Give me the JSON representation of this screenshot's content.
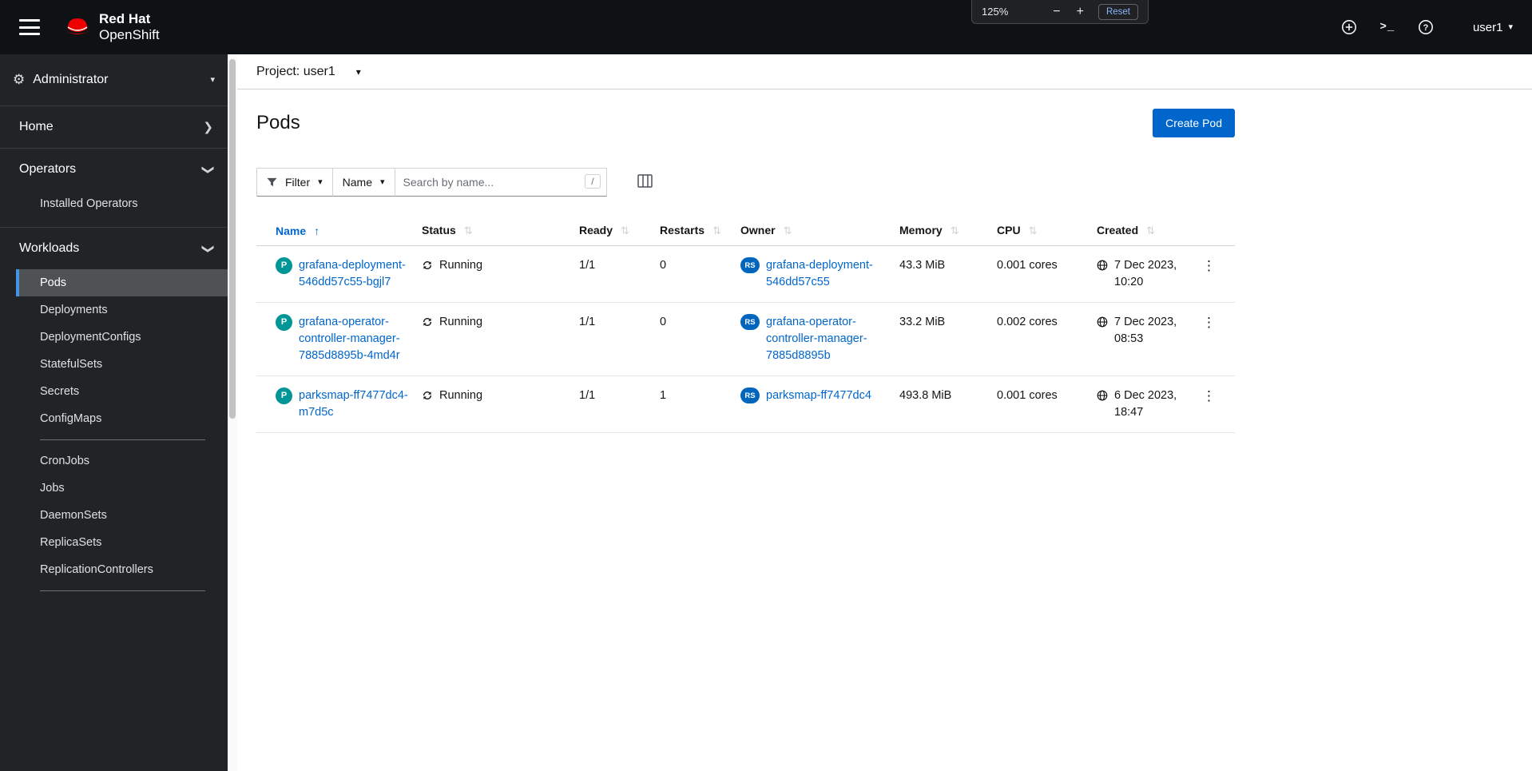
{
  "colors": {
    "accent": "#0066cc",
    "masthead_bg": "#0f1214",
    "sidebar_bg": "#212427",
    "pod_badge": "#009596",
    "replicaset_badge": "#0065bd",
    "brand_red": "#ee0000",
    "selected_nav_border": "#4394e5"
  },
  "masthead": {
    "brand_line1": "Red Hat",
    "brand_line2": "OpenShift",
    "terminal_glyph": ">_",
    "user_label": "user1"
  },
  "zoom_popup": {
    "level": "125%",
    "minus": "−",
    "plus": "+",
    "reset_label": "Reset"
  },
  "sidebar": {
    "perspective_label": "Administrator",
    "home_label": "Home",
    "operators_label": "Operators",
    "installed_operators_label": "Installed Operators",
    "workloads_label": "Workloads",
    "workloads_items": [
      "Pods",
      "Deployments",
      "DeploymentConfigs",
      "StatefulSets",
      "Secrets",
      "ConfigMaps",
      "CronJobs",
      "Jobs",
      "DaemonSets",
      "ReplicaSets",
      "ReplicationControllers"
    ],
    "selected_item": "Pods"
  },
  "project_bar": {
    "label": "Project: user1"
  },
  "page": {
    "title": "Pods",
    "create_button_label": "Create Pod"
  },
  "toolbar": {
    "filter_label": "Filter",
    "attribute_label": "Name",
    "search_placeholder": "Search by name...",
    "search_value": "",
    "shortcut_hint": "/"
  },
  "table": {
    "columns": [
      "Name",
      "Status",
      "Ready",
      "Restarts",
      "Owner",
      "Memory",
      "CPU",
      "Created"
    ],
    "sorted_by": "Name",
    "sort_direction": "ascending",
    "rows": [
      {
        "badge": "P",
        "name": "grafana-deployment-546dd57c55-bgjl7",
        "status": "Running",
        "ready": "1/1",
        "restarts": "0",
        "owner_badge": "RS",
        "owner": "grafana-deployment-546dd57c55",
        "memory": "43.3 MiB",
        "cpu": "0.001 cores",
        "created": "7 Dec 2023, 10:20"
      },
      {
        "badge": "P",
        "name": "grafana-operator-controller-manager-7885d8895b-4md4r",
        "status": "Running",
        "ready": "1/1",
        "restarts": "0",
        "owner_badge": "RS",
        "owner": "grafana-operator-controller-manager-7885d8895b",
        "memory": "33.2 MiB",
        "cpu": "0.002 cores",
        "created": "7 Dec 2023, 08:53"
      },
      {
        "badge": "P",
        "name": "parksmap-ff7477dc4-m7d5c",
        "status": "Running",
        "ready": "1/1",
        "restarts": "1",
        "owner_badge": "RS",
        "owner": "parksmap-ff7477dc4",
        "memory": "493.8 MiB",
        "cpu": "0.001 cores",
        "created": "6 Dec 2023, 18:47"
      }
    ]
  }
}
